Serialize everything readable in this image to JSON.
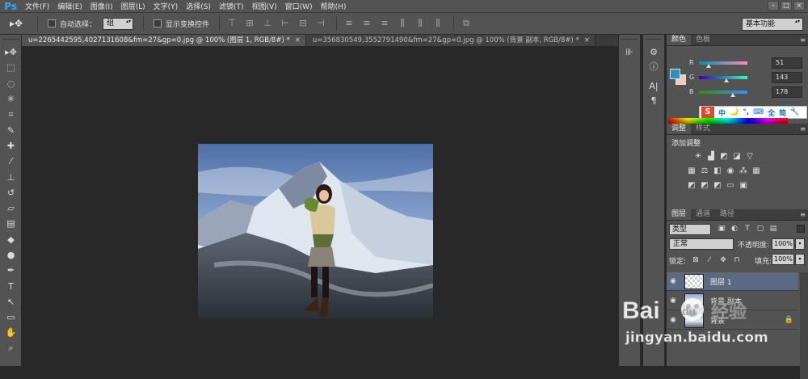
{
  "app": {
    "logo": "Ps"
  },
  "menu": [
    "文件(F)",
    "编辑(E)",
    "图像(I)",
    "图层(L)",
    "文字(Y)",
    "选择(S)",
    "滤镜(T)",
    "视图(V)",
    "窗口(W)",
    "帮助(H)"
  ],
  "window_controls": [
    "–",
    "□",
    "×"
  ],
  "options": {
    "auto_select_label": "自动选择：",
    "auto_select_value": "组",
    "show_transform_label": "显示变换控件",
    "workspace": "基本功能"
  },
  "tabs": [
    {
      "label": "u=2265442595,4027131608&fm=27&gp=0.jpg @ 100% (图层 1, RGB/8#) *",
      "close": "×"
    },
    {
      "label": "u=356830549,3552791490&fm=27&gp=0.jpg @ 100% (背景 副本, RGB/8#) *",
      "close": "×"
    }
  ],
  "colors": {
    "fg": "#338fb2",
    "bg": "#f5c7c0",
    "accent": "#31a8ff",
    "selected_layer": "#5b6a82"
  },
  "color_panel": {
    "tabs": [
      "颜色",
      "色板"
    ],
    "channels": [
      {
        "label": "R",
        "value": "51",
        "level": 0.2
      },
      {
        "label": "G",
        "value": "143",
        "level": 0.56
      },
      {
        "label": "B",
        "value": "178",
        "level": 0.7
      }
    ]
  },
  "ime": {
    "logo": "S",
    "items": [
      "中",
      "🌙",
      "°,",
      "⌨",
      "全",
      "简",
      "🔧"
    ]
  },
  "adjustments": {
    "tabs": [
      "调整",
      "样式"
    ],
    "title": "添加调整"
  },
  "layers": {
    "tabs": [
      "图层",
      "通道",
      "路径"
    ],
    "filter": "类型",
    "blend_mode": "正常",
    "opacity_label": "不透明度:",
    "opacity": "100%",
    "lock_label": "锁定:",
    "fill_label": "填充:",
    "fill": "100%",
    "items": [
      {
        "name": "图层 1",
        "selected": true
      },
      {
        "name": "背景 副本",
        "selected": false
      },
      {
        "name": "背景",
        "selected": false
      }
    ]
  },
  "watermark": {
    "brand": "Bai",
    "paw": "du",
    "brand_cn": "经验",
    "url": "jingyan.baidu.com"
  }
}
